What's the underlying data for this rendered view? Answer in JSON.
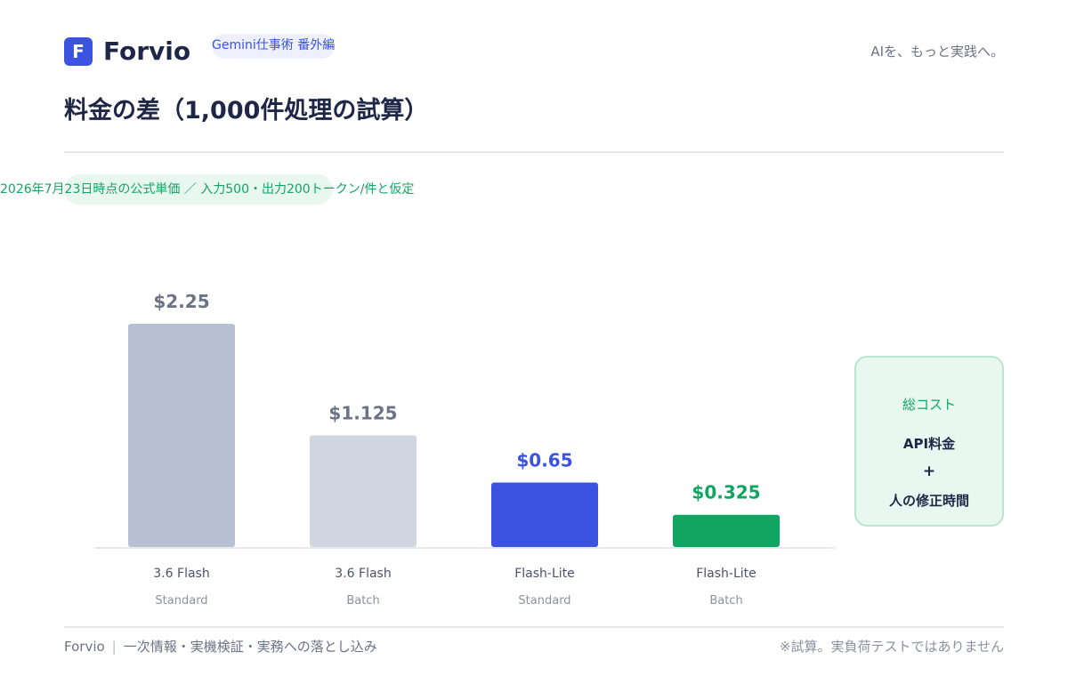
{
  "header": {
    "logo_letter": "F",
    "brand": "Forvio",
    "series_label": "Gemini仕事術 番外編",
    "tagline": "AIを、もっと実践へ。"
  },
  "title": "料金の差（1,000件処理の試算）",
  "note": "2026年7月23日時点の公式単価 ／ 入力500・出力200トークン/件と仮定",
  "side_box": {
    "title": "総コスト",
    "line1": "API料金",
    "plus": "+",
    "line2": "人の修正時間"
  },
  "footer": {
    "left_brand": "Forvio",
    "separator": "|",
    "left_text": "一次情報・実機検証・実務への落とし込み",
    "right_text": "※試算。実負荷テストではありません"
  },
  "colors": {
    "accent_blue": "#3b53e0",
    "accent_green": "#11a562",
    "bar_gray_dark": "#b8c1d3",
    "bar_gray_light": "#d0d5e2",
    "label_gray": "#6b7385"
  },
  "chart_data": {
    "type": "bar",
    "categories": [
      "3.6 Flash",
      "3.6 Flash",
      "Flash-Lite",
      "Flash-Lite"
    ],
    "subcategories": [
      "Standard",
      "Batch",
      "Standard",
      "Batch"
    ],
    "values": [
      2.25,
      1.125,
      0.65,
      0.325
    ],
    "value_labels": [
      "$2.25",
      "$1.125",
      "$0.65",
      "$0.325"
    ],
    "bar_colors": [
      "#b8c1d3",
      "#d0d5e2",
      "#3b53e0",
      "#11a562"
    ],
    "label_colors": [
      "#6b7385",
      "#6b7385",
      "#3b53e0",
      "#11a562"
    ],
    "ylim": [
      0,
      2.25
    ],
    "grid": false,
    "title": "",
    "xlabel": "",
    "ylabel": ""
  }
}
